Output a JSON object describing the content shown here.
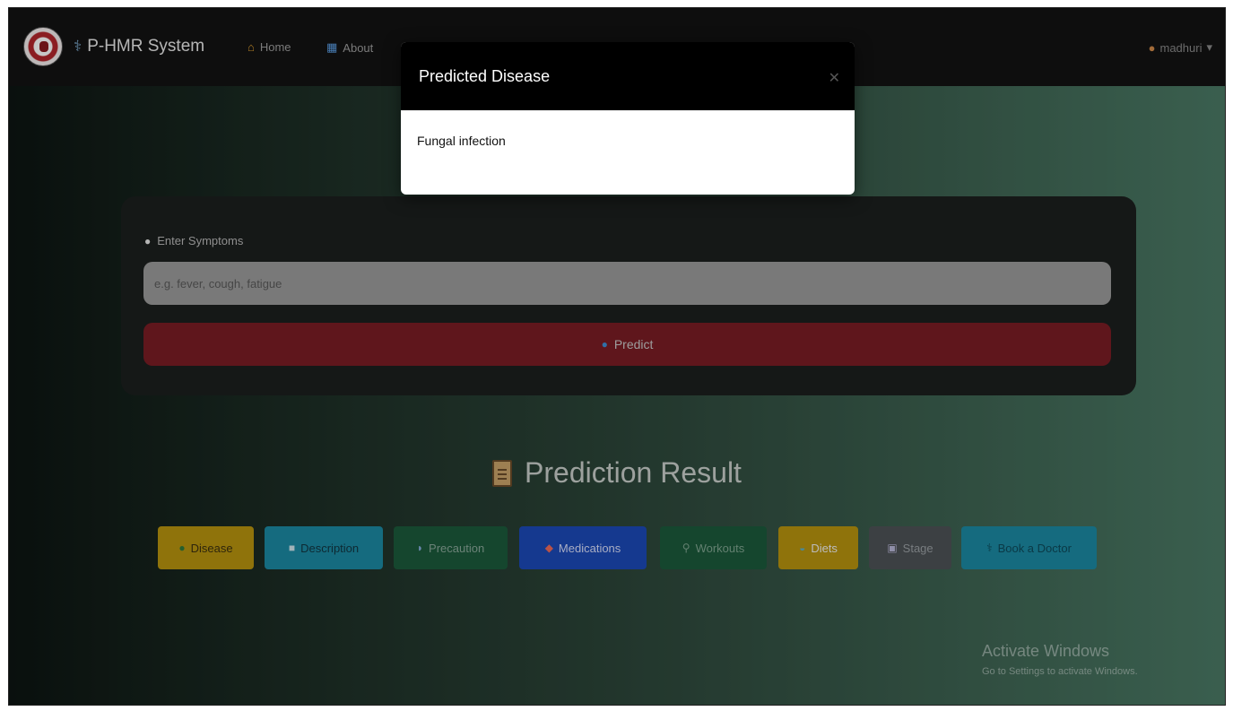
{
  "navbar": {
    "brand": "P-HMR System",
    "home_label": "Home",
    "about_label": "About",
    "user_label": "madhuri"
  },
  "symptoms": {
    "label": "Enter Symptoms",
    "placeholder": "e.g. fever, cough, fatigue",
    "predict_label": "Predict"
  },
  "results": {
    "title": "Prediction Result",
    "buttons": [
      {
        "label": "Disease",
        "color": "#b8940f"
      },
      {
        "label": "Description",
        "color": "#1b8aa3"
      },
      {
        "label": "Precaution",
        "color": "#1c5a3c"
      },
      {
        "label": "Medications",
        "color": "#1c49b8"
      },
      {
        "label": "Workouts",
        "color": "#1c5a3c"
      },
      {
        "label": "Diets",
        "color": "#b8940f"
      },
      {
        "label": "Stage",
        "color": "#4e5256"
      },
      {
        "label": "Book a Doctor",
        "color": "#1b8aa3"
      }
    ]
  },
  "modal": {
    "title": "Predicted Disease",
    "body": "Fungal infection"
  },
  "watermark": {
    "title": "Activate Windows",
    "subtitle": "Go to Settings to activate Windows."
  }
}
